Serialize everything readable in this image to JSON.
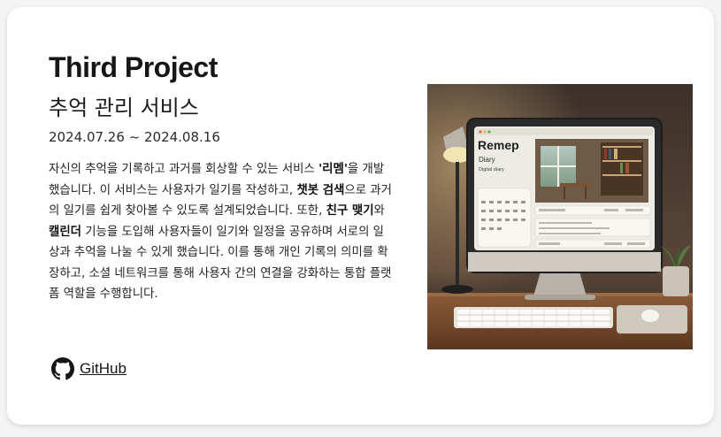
{
  "project": {
    "title": "Third Project",
    "subtitle": "추억 관리 서비스",
    "period": "2024.07.26 ~ 2024.08.16",
    "description": [
      {
        "text": "자신의 추억을 기록하고 과거를 회상할 수 있는 서비스 ",
        "bold": false
      },
      {
        "text": "'리멤'",
        "bold": true
      },
      {
        "text": "을 개발했습니다. 이 서비스는 사용자가 일기를 작성하고, ",
        "bold": false
      },
      {
        "text": "챗봇 검색",
        "bold": true
      },
      {
        "text": "으로 과거의 일기를 쉽게 찾아볼 수 있도록 설계되었습니다. 또한, ",
        "bold": false
      },
      {
        "text": "친구 맺기",
        "bold": true
      },
      {
        "text": "와 ",
        "bold": false
      },
      {
        "text": "캘린더",
        "bold": true
      },
      {
        "text": " 기능을 도입해 사용자들이 일기와 일정을 공유하며 서로의 일상과 추억을 나눌 수 있게 했습니다. 이를 통해 개인 기록의 의미를 확장하고, 소셜 네트워크를 통해 사용자 간의 연결을 강화하는 통합 플랫폼 역할을 수행합니다.",
        "bold": false
      }
    ],
    "github_label": " GitHub"
  },
  "illustration": {
    "app_name": "Remep",
    "app_sub": "Diary",
    "app_tag": "Digital diary"
  },
  "icons": {
    "github": "github-icon"
  },
  "colors": {
    "title": "#161616",
    "card_bg": "#ffffff",
    "page_bg": "#f4f4f5"
  }
}
